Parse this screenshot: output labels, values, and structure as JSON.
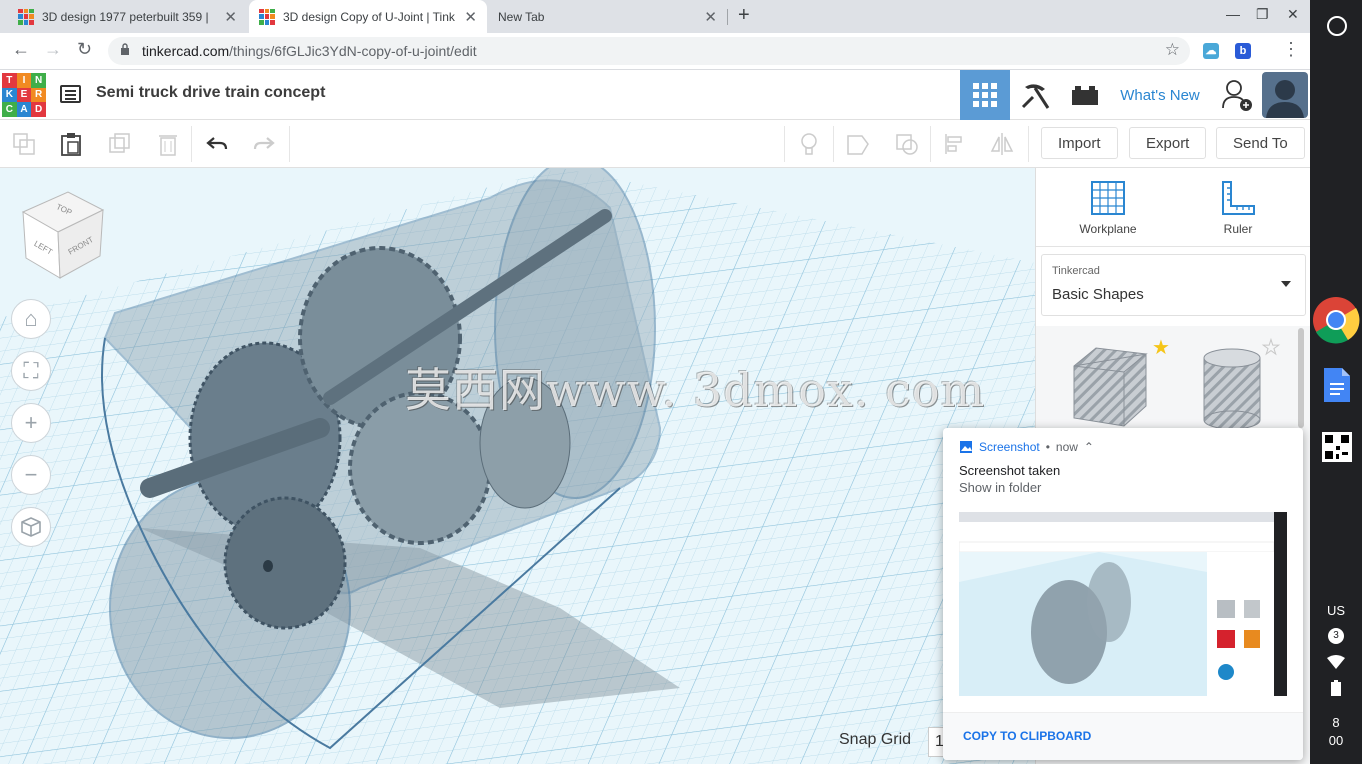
{
  "browser": {
    "tabs": [
      {
        "title": "3D design 1977 peterbuilt 359 |",
        "active": false
      },
      {
        "title": "3D design Copy of U-Joint | Tink",
        "active": true
      },
      {
        "title": "New Tab",
        "active": false
      }
    ],
    "new_tab_glyph": "+",
    "url_host": "tinkercad.com",
    "url_path": "/things/6fGLJic3YdN-copy-of-u-joint/edit"
  },
  "app": {
    "logo_letters": [
      "TIN",
      "KER",
      "CAD"
    ],
    "design_title": "Semi truck drive train concept",
    "whats_new": "What's New"
  },
  "toolbar": {
    "import": "Import",
    "export": "Export",
    "send_to": "Send To"
  },
  "viewcube": {
    "top": "TOP",
    "left": "LEFT",
    "front": "FRONT"
  },
  "workspace": {
    "watermark": "莫西网www. 3dmox. com",
    "snap_grid_label": "Snap Grid",
    "snap_grid_value": "1"
  },
  "panel": {
    "workplane": "Workplane",
    "ruler": "Ruler",
    "library_source": "Tinkercad",
    "library_name": "Basic Shapes"
  },
  "notification": {
    "app": "Screenshot",
    "time": "now",
    "title": "Screenshot taken",
    "subtitle": "Show in folder",
    "action": "COPY TO CLIPBOARD"
  },
  "shelf": {
    "keyboard": "US",
    "notifications_count": "3",
    "time_hour": "8",
    "time_minute": "00"
  },
  "colors": {
    "tinkercad_blue": "#2a86d1",
    "grid_bg": "#e9f6fb",
    "logo_red": "#e2383f",
    "logo_orange": "#f18a21",
    "logo_green": "#3fae49",
    "logo_blue": "#2a86d1"
  }
}
